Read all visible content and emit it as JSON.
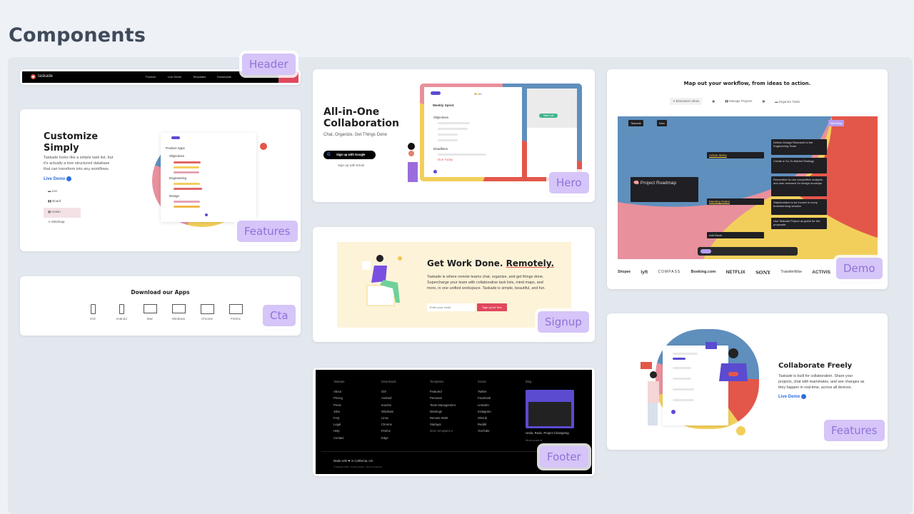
{
  "page_title": "Components",
  "badges": {
    "header": "Header",
    "features1": "Features",
    "cta": "Cta",
    "hero": "Hero",
    "signup": "Signup",
    "footer": "Footer",
    "demo": "Demo",
    "features2": "Features"
  },
  "header": {
    "logo": "taskade",
    "nav": [
      "Product",
      "Live Demo",
      "Templates",
      "Downloads"
    ]
  },
  "features1": {
    "title": "Customize Simply",
    "body": "Taskade looks like a simple task list, but it's actually a tree structured database that can transform into any workflows.",
    "link": "Live Demo",
    "views": [
      "List",
      "Board",
      "Action",
      "Mindmap"
    ],
    "selected_view": "Action",
    "mock": {
      "doc_title": "Product Apps",
      "groups": [
        "Objectives",
        "Engineering",
        "Design"
      ]
    }
  },
  "cta": {
    "title": "Download our Apps",
    "apps": [
      "iOS",
      "Android",
      "Mac",
      "Windows",
      "Chrome",
      "Firefox"
    ]
  },
  "hero": {
    "title": "All-in-One Collaboration",
    "subtitle": "Chat, Organize, Get Things Done",
    "google_button": "Sign up with Google",
    "email_link": "Sign up with Email",
    "mock": {
      "doc_title": "Weekly Sprint",
      "section1": "Objectives",
      "section2": "Deadlines",
      "due": "Due Today",
      "call": "Start Call"
    }
  },
  "signup": {
    "title_a": "Get Work Done. ",
    "title_b": "Remotely.",
    "body": "Taskade is where remote teams chat, organize, and get things done. Supercharge your team with collaborative task lists, mind maps, and more, in one unified workspace. Taskade is simple, beautiful, and fun.",
    "placeholder": "Enter your email",
    "button": "Sign up for free"
  },
  "footer": {
    "columns": [
      {
        "title": "Taskade",
        "items": [
          "About",
          "Pricing",
          "Press",
          "Jobs",
          "FAQ",
          "Legal",
          "Help",
          "Contact"
        ]
      },
      {
        "title": "Downloads",
        "items": [
          "iOS",
          "Android",
          "macOS",
          "Windows",
          "Linux",
          "Chrome",
          "Firefox",
          "Edge"
        ]
      },
      {
        "title": "Templates",
        "items": [
          "Featured",
          "Personal",
          "Team Management",
          "Meetings",
          "Remote Work",
          "Startups",
          "More templates ▾"
        ]
      },
      {
        "title": "Social",
        "items": [
          "Twitter",
          "Facebook",
          "LinkedIn",
          "Instagram",
          "GitHub",
          "Reddit",
          "YouTube"
        ]
      }
    ],
    "blog_title": "Blog",
    "blog_post": "Undo, Redo, Project Changelog",
    "more_posts": "More posts ▾",
    "made_with": "Made with ❤ in California, US",
    "legal": "© Taskade 2020 · Privacy Policy · Terms of Service"
  },
  "demo": {
    "title": "Map out your workflow, from ideas to action.",
    "steps": [
      "Brainstorm Ideas",
      "Manage Projects",
      "Organize Tasks"
    ],
    "mindmap": {
      "root": "Project Roadmap",
      "branch1": "Action Items",
      "branch2": "Meeting Notes",
      "add": "Add Block",
      "tasks": [
        "Deliver Design Research to the Engineering Team",
        "Create a Go-To-Market Strategy",
        "Remember to use competitive analysis and user research for design mockups",
        "Stakeholders to be involve in every brainstorming session",
        "Use Taskade Project as guide for the proposals"
      ],
      "workspace": "Taskade",
      "new": "New",
      "mode": "Mindmap"
    },
    "logos": [
      "Shopee",
      "lyft",
      "COMPASS",
      "Booking.com",
      "NETFLIX",
      "SONY",
      "TransferWise",
      "ACTIVIS"
    ]
  },
  "features2": {
    "title": "Collaborate Freely",
    "body": "Taskade is built for collaboration. Share your projects, chat with teammates, and see changes as they happen in real-time, across all devices.",
    "link": "Live Demo"
  },
  "colors": {
    "badge_bg": "#d5c5f8",
    "badge_text": "#8d73d8",
    "blue": "#5f8fbd",
    "red": "#e3574a",
    "yellow": "#f2cf5b",
    "pink": "#e8909c",
    "purple": "#5b4bd0",
    "link": "#2f6ee0"
  }
}
